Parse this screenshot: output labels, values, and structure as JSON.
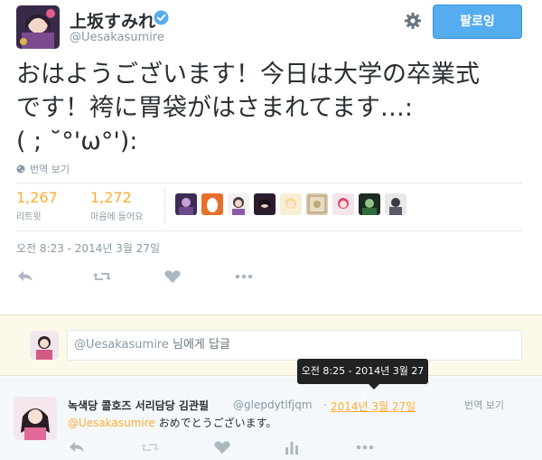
{
  "tweet": {
    "display_name": "上坂すみれ",
    "screen_name": "@Uesakasumire",
    "follow_label": "팔로잉",
    "text": "おはようございます！今日は大学の卒業式\nです！袴に胃袋がはさまれてます…:\n( ; ˘°'ω°'):",
    "translate_label": "번역 보기",
    "retweets": {
      "count": "1,267",
      "label": "리트윗"
    },
    "favorites": {
      "count": "1,272",
      "label": "마음에 들어요"
    },
    "timestamp": "오전 8:23 - 2014년 3월 27일"
  },
  "reply_box": {
    "mention": "@Uesakasumire",
    "suffix": " 님에게 답글"
  },
  "tooltip": {
    "text": "오전 8:25 - 2014년 3월 27일"
  },
  "reply_tweet": {
    "name": "녹색당 콜호즈 서리담당 김관필",
    "handle": "@glepdytlfjqm",
    "separator": "·",
    "time": "2014년 3월 27일",
    "translate_label": "번역 보기",
    "mention": "@Uesakasumire",
    "text": " おめでとうございます。"
  },
  "colors": {
    "accent": "#55acee",
    "highlight": "#ffac33",
    "muted": "#8899a6",
    "text": "#292f33"
  },
  "icons": {
    "verified": "verified-badge-icon",
    "settings": "gear-icon",
    "translate": "globe-icon",
    "reply": "reply-icon",
    "retweet": "retweet-icon",
    "like": "heart-icon",
    "more": "more-icon",
    "analytics": "analytics-icon"
  }
}
